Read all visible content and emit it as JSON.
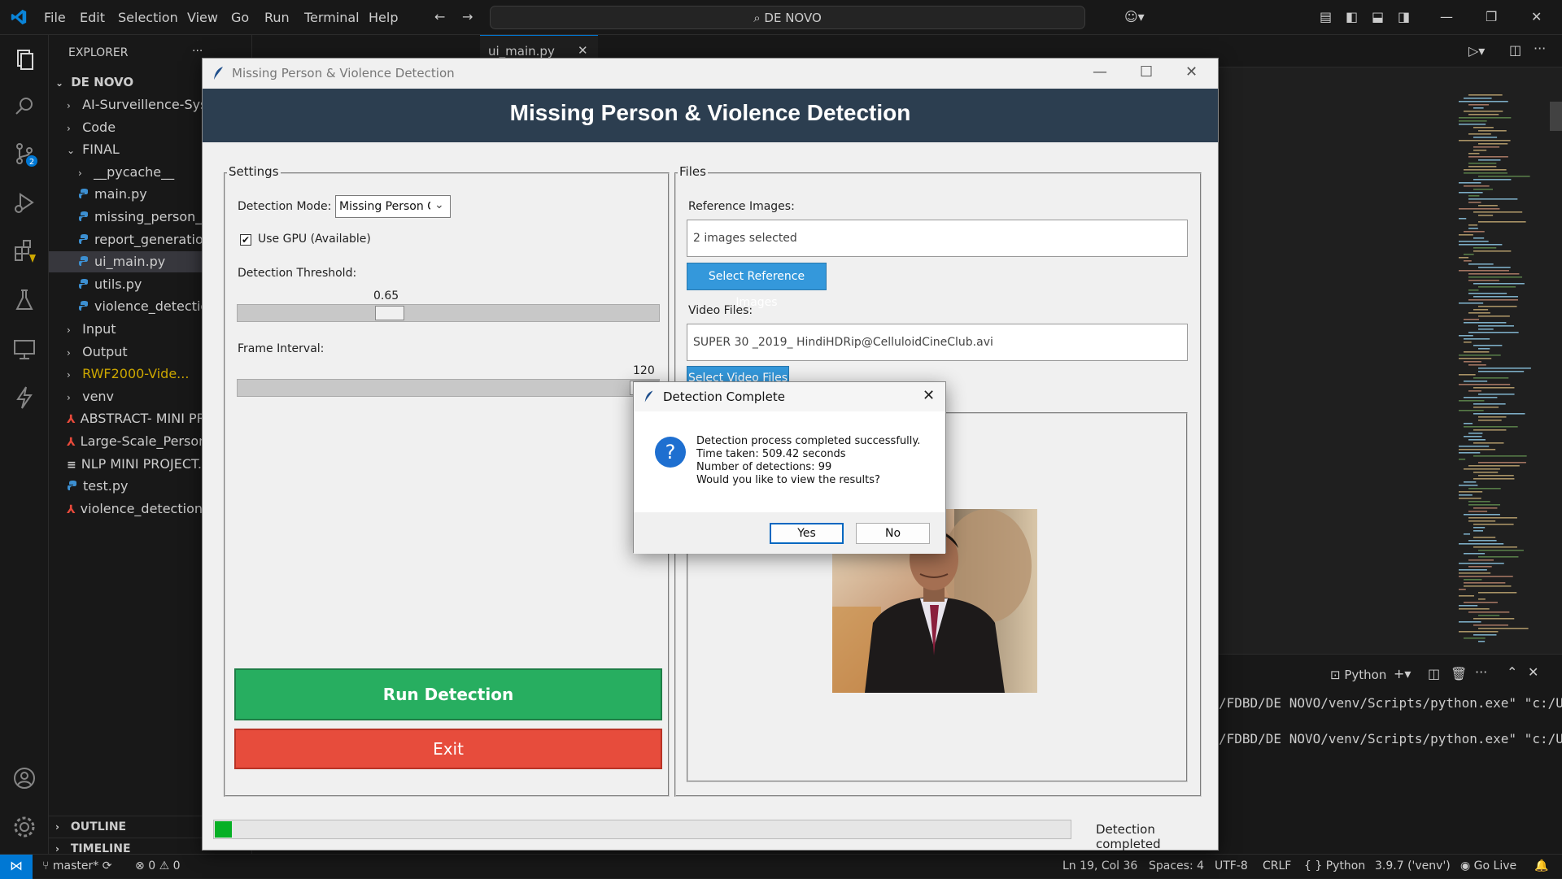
{
  "vscode": {
    "menu": [
      "File",
      "Edit",
      "Selection",
      "View",
      "Go",
      "Run",
      "Terminal",
      "Help"
    ],
    "search_text": "DE NOVO",
    "explorer_title": "EXPLORER",
    "explorer_more": "···",
    "editor_tab": "ui_main.py",
    "source_control_badge": "2",
    "tree": {
      "root": "DE NOVO",
      "items": [
        {
          "label": "AI-Surveillence-Syste",
          "kind": "folder",
          "depth": 1
        },
        {
          "label": "Code",
          "kind": "folder",
          "depth": 1
        },
        {
          "label": "FINAL",
          "kind": "folder-open",
          "depth": 1
        },
        {
          "label": "__pycache__",
          "kind": "folder",
          "depth": 2
        },
        {
          "label": "main.py",
          "kind": "py",
          "depth": 2
        },
        {
          "label": "missing_person_de",
          "kind": "py",
          "depth": 2
        },
        {
          "label": "report_generation.p",
          "kind": "py",
          "depth": 2
        },
        {
          "label": "ui_main.py",
          "kind": "py",
          "depth": 2,
          "selected": true
        },
        {
          "label": "utils.py",
          "kind": "py",
          "depth": 2
        },
        {
          "label": "violence_detection.",
          "kind": "py",
          "depth": 2
        },
        {
          "label": "Input",
          "kind": "folder",
          "depth": 1
        },
        {
          "label": "Output",
          "kind": "folder",
          "depth": 1
        },
        {
          "label": "RWF2000-Vide...",
          "kind": "folder",
          "depth": 1,
          "color": "#cca700"
        },
        {
          "label": "venv",
          "kind": "folder",
          "depth": 1
        },
        {
          "label": "ABSTRACT- MINI PR",
          "kind": "pdf",
          "depth": 1
        },
        {
          "label": "Large-Scale_Person_",
          "kind": "pdf",
          "depth": 1
        },
        {
          "label": "NLP MINI PROJECT.p",
          "kind": "txt",
          "depth": 1
        },
        {
          "label": "test.py",
          "kind": "py",
          "depth": 1
        },
        {
          "label": "violence_detections.",
          "kind": "pdf",
          "depth": 1
        }
      ],
      "outline": "OUTLINE",
      "timeline": "TIMELINE"
    },
    "terminal": {
      "shell": "Python",
      "lines": [
        "/FDBD/DE NOVO/venv/Scripts/python.exe\" \"c:/Us",
        "/FDBD/DE NOVO/venv/Scripts/python.exe\" \"c:/Us"
      ]
    },
    "status": {
      "branch": "master*",
      "errors": "0",
      "warnings": "0",
      "position": "Ln 19, Col 36",
      "spaces": "Spaces: 4",
      "encoding": "UTF-8",
      "eol": "CRLF",
      "language_braces": "{ }",
      "language": "Python",
      "interpreter": "3.9.7 ('venv')",
      "golive": "Go Live"
    }
  },
  "app": {
    "window_title": "Missing Person & Violence Detection",
    "header_title": "Missing Person & Violence Detection",
    "settings": {
      "frame_label": "Settings",
      "mode_label": "Detection Mode:",
      "mode_value": "Missing Person C",
      "gpu_label": "Use GPU (Available)",
      "gpu_checked": true,
      "threshold_label": "Detection Threshold:",
      "threshold_value": "0.65",
      "threshold_fraction": 0.35,
      "interval_label": "Frame Interval:",
      "interval_value": "120",
      "interval_fraction": 1.0
    },
    "files": {
      "frame_label": "Files",
      "ref_label": "Reference Images:",
      "ref_value": "2 images selected",
      "ref_button": "Select Reference Images",
      "video_label": "Video Files:",
      "video_value": "SUPER 30 _2019_ HindiHDRip@CelluloidCineClub.avi",
      "video_button": "Select Video Files"
    },
    "run_button": "Run Detection",
    "exit_button": "Exit",
    "progress_fraction": 0.02,
    "status_text": "Detection completed",
    "colors": {
      "header": "#2c3e50",
      "run": "#27ae60",
      "exit": "#e74c3c",
      "button": "#3498db",
      "progress": "#06b025"
    }
  },
  "dialog": {
    "title": "Detection Complete",
    "line1": "Detection process completed successfully.",
    "line2": "Time taken: 509.42 seconds",
    "line3": "Number of detections: 99",
    "line4": "Would you like to view the results?",
    "yes": "Yes",
    "no": "No",
    "icon": "question-icon"
  }
}
